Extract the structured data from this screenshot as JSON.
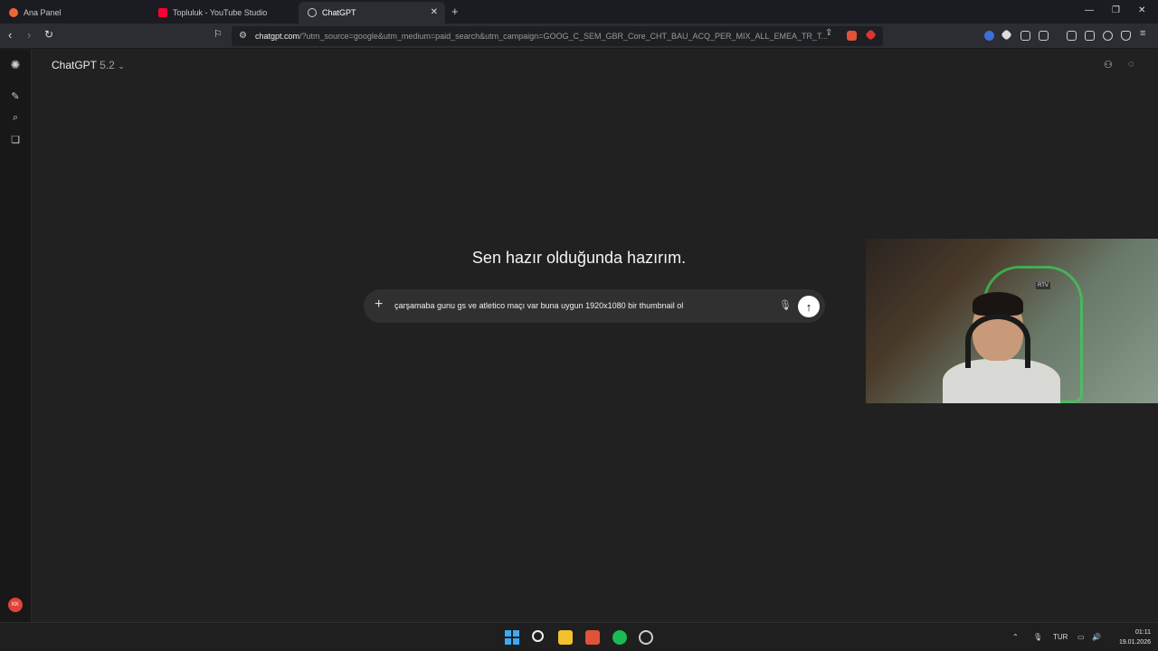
{
  "browser": {
    "tabs": [
      {
        "label": "Ana Panel",
        "favicon_color": "#e8683a"
      },
      {
        "label": "Topluluk - YouTube Studio",
        "favicon_color": "#ff0033"
      },
      {
        "label": "ChatGPT",
        "favicon_color": "#cccccc"
      }
    ],
    "url_host": "chatgpt.com",
    "url_rest": "/?utm_source=google&utm_medium=paid_search&utm_campaign=GOOG_C_SEM_GBR_Core_CHT_BAU_ACQ_PER_MIX_ALL_EMEA_TR_T...",
    "new_tab_icon": "+"
  },
  "app": {
    "model_name": "ChatGPT",
    "model_version": "5.2",
    "heading": "Sen hazır olduğunda hazırım.",
    "composer": {
      "plus_icon": "+",
      "text": "çarşamaba gunu gs ve atletico maçı var buna uygun 1920x1080 bir thumbnail ol",
      "send_icon": "↑"
    },
    "avatar_initials": "KK"
  },
  "webcam": {
    "overlay_text": "RTV"
  },
  "taskbar": {
    "language": "TUR",
    "time": "01:11",
    "date": "19.01.2026"
  },
  "colors": {
    "background": "#212121",
    "sidebar": "#181818",
    "composer": "#303030",
    "accent_red": "#e0433a"
  }
}
